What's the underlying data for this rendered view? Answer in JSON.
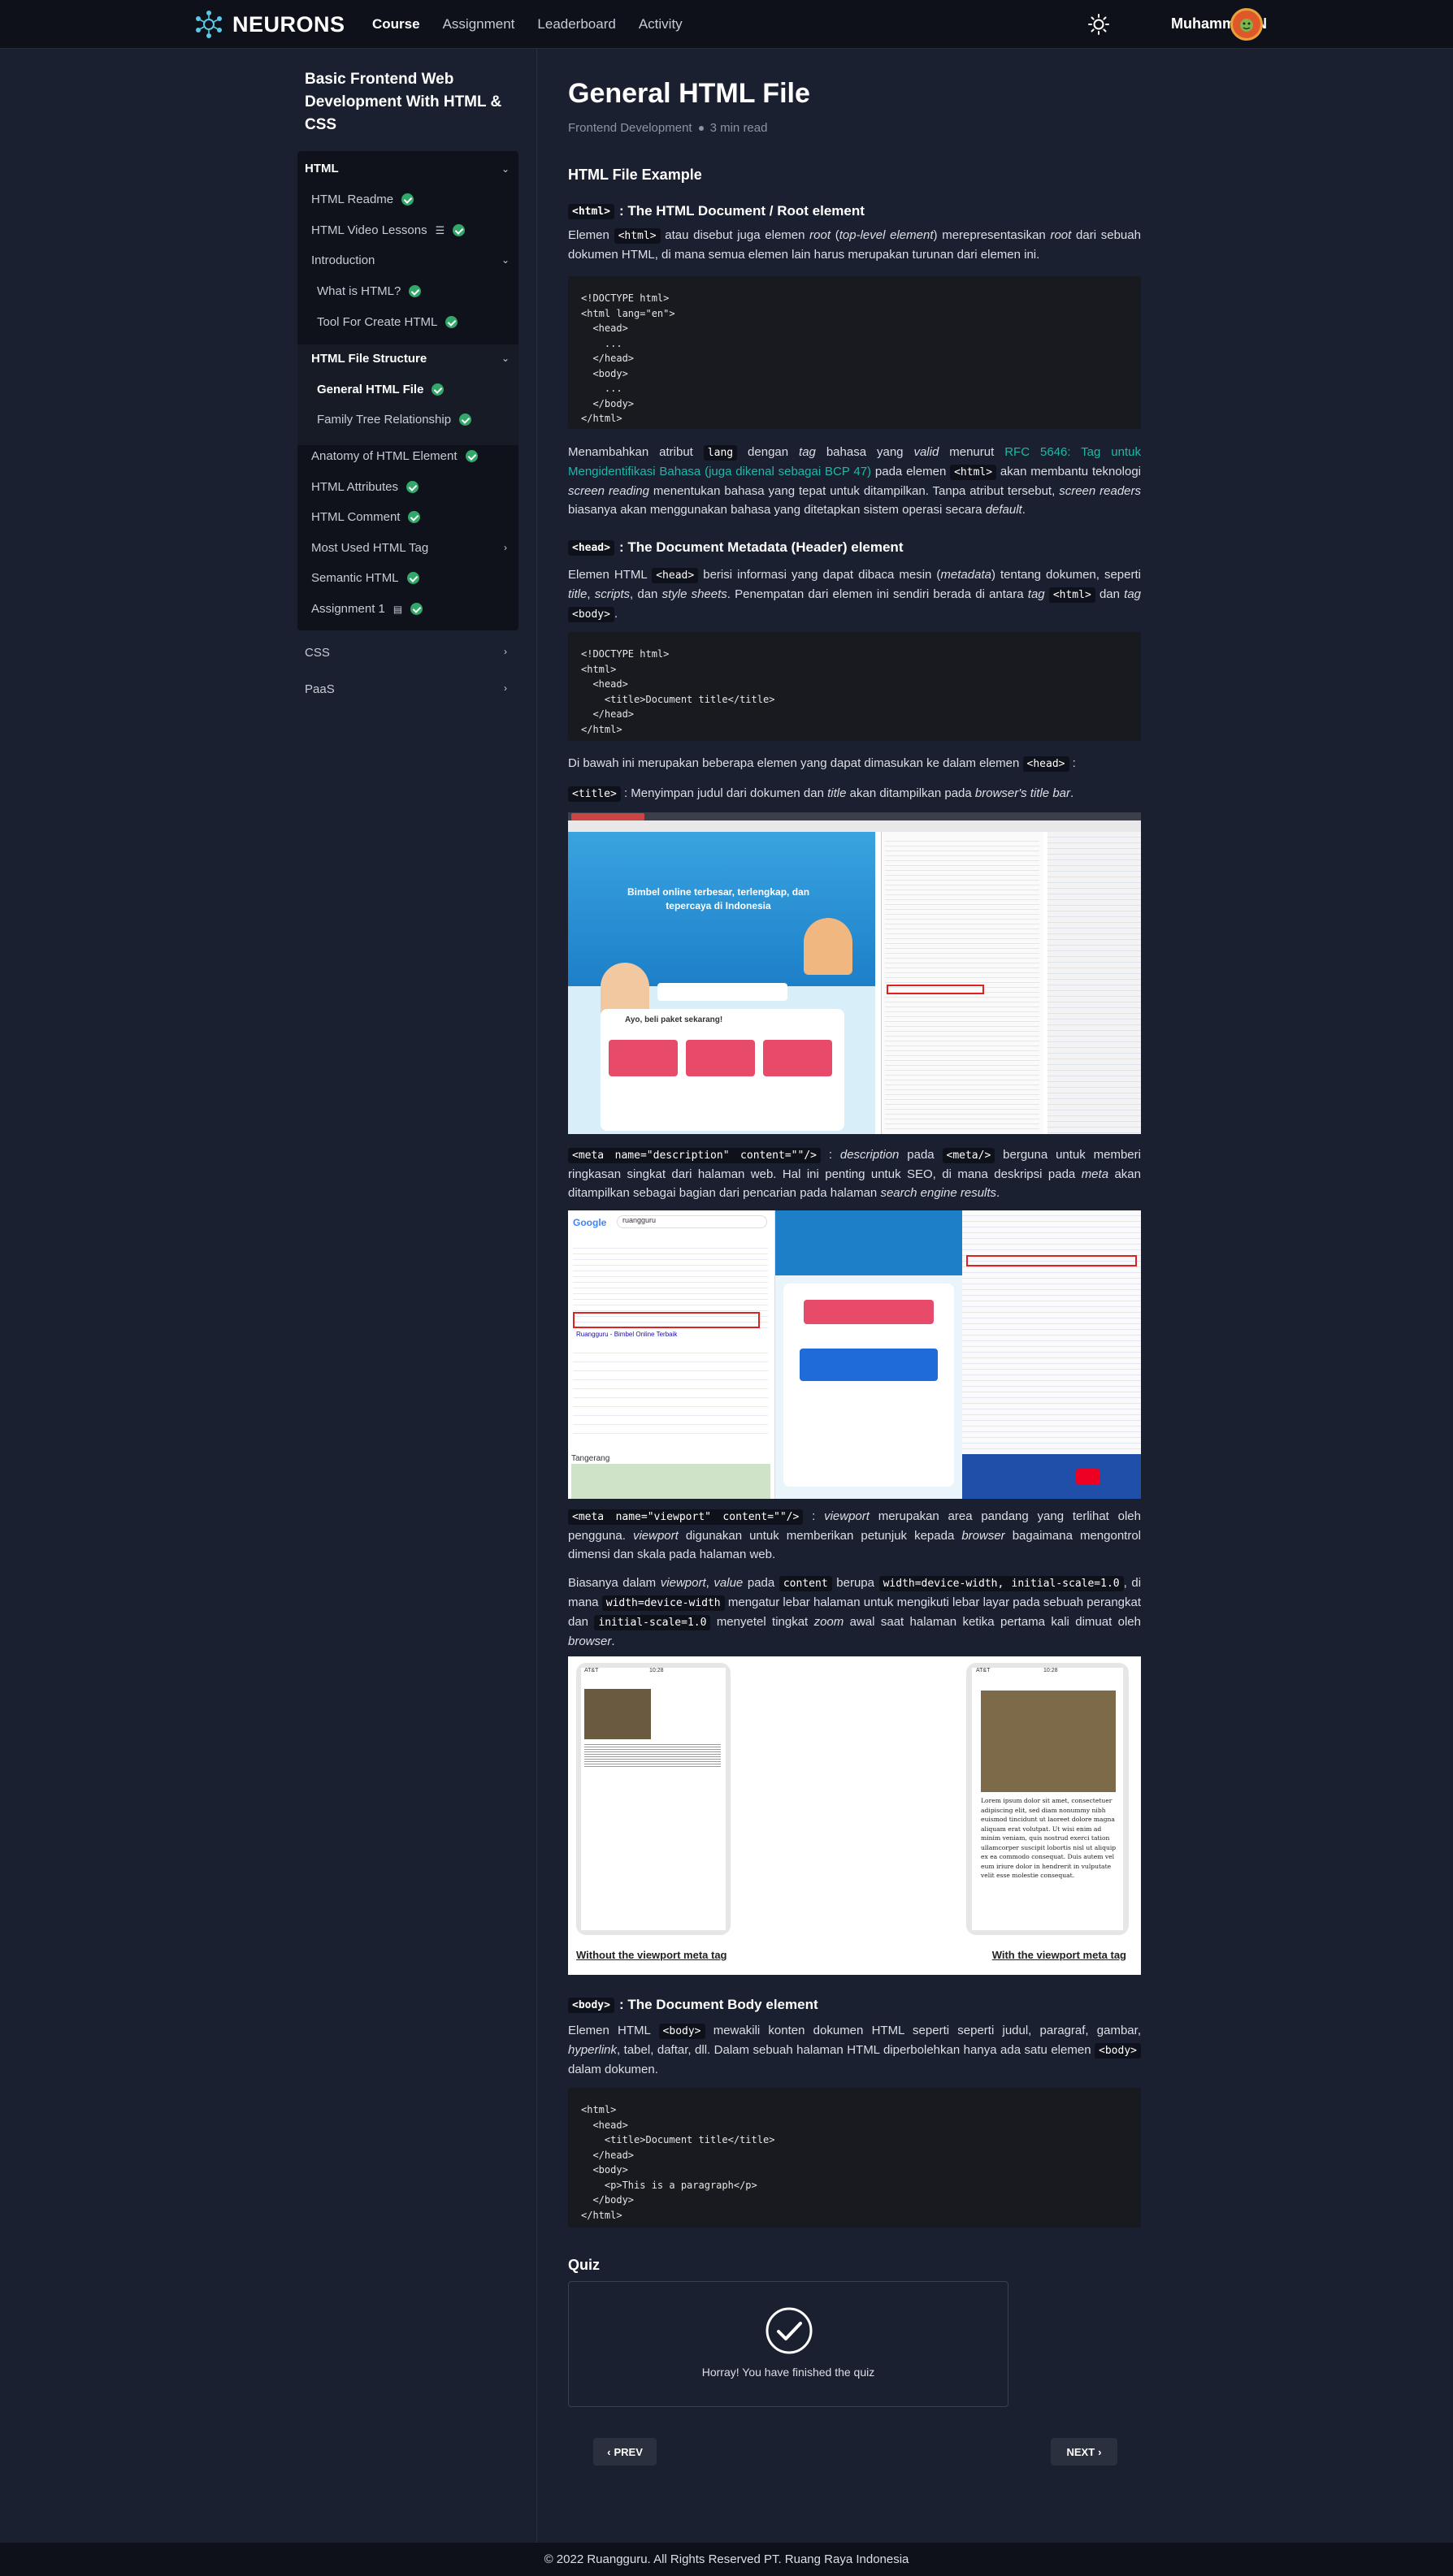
{
  "brand": {
    "name": "NEURONS"
  },
  "nav": {
    "items": [
      "Course",
      "Assignment",
      "Leaderboard",
      "Activity"
    ]
  },
  "user": {
    "name": "Muhammad N"
  },
  "sidebar": {
    "course_title": "Basic Frontend Web Development With HTML & CSS",
    "section_html": "HTML",
    "items": {
      "html_readme": "HTML Readme",
      "html_video": "HTML Video Lessons",
      "introduction": "Introduction",
      "what_is_html": "What is HTML?",
      "tool": "Tool For Create HTML",
      "file_structure": "HTML File Structure",
      "general_html_file": "General HTML File",
      "family_tree": "Family Tree Relationship",
      "anatomy": "Anatomy of HTML Element",
      "attributes": "HTML Attributes",
      "comment": "HTML Comment",
      "most_used": "Most Used HTML Tag",
      "semantic": "Semantic HTML",
      "assignment1": "Assignment 1"
    },
    "section_css": "CSS",
    "section_paas": "PaaS"
  },
  "article": {
    "title": "General HTML File",
    "category": "Frontend Development",
    "read_time": "3 min read",
    "h_example": "HTML File Example",
    "h_html_tag": "<html>",
    "h_html_rest": ": The HTML Document / Root element",
    "p1": {
      "a": "Elemen",
      "code": "<html>",
      "b": "atau disebut juga elemen",
      "em1": "root",
      "c": "(",
      "em2": "top-level element",
      "d": ") merepresentasikan",
      "em3": "root",
      "e": "dari sebuah dokumen HTML, di mana semua elemen lain harus merupakan turunan dari elemen ini."
    },
    "code1": "<!DOCTYPE html>\n<html lang=\"en\">\n  <head>\n    ...\n  </head>\n  <body>\n    ...\n  </body>\n</html>",
    "p2": {
      "a": "Menambahkan atribut",
      "code1": "lang",
      "b": "dengan",
      "em1": "tag",
      "c": "bahasa yang",
      "em2": "valid",
      "d": "menurut",
      "link": "RFC 5646: Tag untuk Mengidentifikasi Bahasa (juga dikenal sebagai BCP 47)",
      "e": "pada elemen",
      "code2": "<html>",
      "f": "akan membantu teknologi",
      "em3": "screen reading",
      "g": "menentukan bahasa yang tepat untuk ditampilkan. Tanpa atribut tersebut,",
      "em4": "screen readers",
      "h": "biasanya akan menggunakan bahasa yang ditetapkan sistem operasi secara",
      "em5": "default",
      "i": "."
    },
    "h_head_tag": "<head>",
    "h_head_rest": ": The Document Metadata (Header) element",
    "p3": {
      "a": "Elemen HTML",
      "code1": "<head>",
      "b": "berisi informasi yang dapat dibaca mesin (",
      "em1": "metadata",
      "c": ") tentang dokumen, seperti",
      "em2": "title",
      "d": ",",
      "em3": "scripts",
      "e": ", dan",
      "em4": "style sheets",
      "f": ". Penempatan dari elemen ini sendiri berada di antara",
      "em5": "tag",
      "code2": "<html>",
      "g": "dan",
      "em6": "tag",
      "code3": "<body>",
      "h": "."
    },
    "code2": "<!DOCTYPE html>\n<html>\n  <head>\n    <title>Document title</title>\n  </head>\n</html>",
    "p4": {
      "a": "Di bawah ini merupakan beberapa elemen yang dapat dimasukan ke dalam elemen",
      "code": "<head>",
      "b": ":"
    },
    "p5": {
      "code": "<title>",
      "a": ": Menyimpan judul dari dokumen dan",
      "em1": "title",
      "b": "akan ditampilkan pada",
      "em2": "browser's title bar",
      "c": "."
    },
    "screenshot1": {
      "headline": "Bimbel online terbesar, terlengkap, dan tepercaya di Indonesia",
      "cta": "Ayo, beli paket sekarang!"
    },
    "p6": {
      "code1": "<meta name=\"description\" content=\"\"/>",
      "a": ":",
      "em1": "description",
      "b": "pada",
      "code2": "<meta/>",
      "c": "berguna untuk memberi ringkasan singkat dari halaman web. Hal ini penting untuk SEO, di mana deskripsi pada",
      "em2": "meta",
      "d": "akan ditampilkan sebagai bagian dari pencarian pada halaman",
      "em3": "search engine results",
      "e": "."
    },
    "screenshot2": {
      "google": "Google",
      "query": "ruangguru",
      "result_title": "Ruangguru - Bimbel Online Terbaik",
      "map_label": "Tangerang"
    },
    "p7": {
      "code": "<meta name=\"viewport\" content=\"\"/>",
      "a": ":",
      "em1": "viewport",
      "b": "merupakan area pandang yang terlihat oleh pengguna.",
      "em2": "viewport",
      "c": "digunakan untuk memberikan petunjuk kepada",
      "em3": "browser",
      "d": "bagaimana mengontrol dimensi dan skala pada halaman web."
    },
    "p8": {
      "a": "Biasanya dalam",
      "em1": "viewport",
      "b": ",",
      "em2": "value",
      "c": "pada",
      "code1": "content",
      "d": "berupa",
      "code2": "width=device-width, initial-scale=1.0",
      "e": ", di mana",
      "code3": "width=device-width",
      "f": "mengatur lebar halaman untuk mengikuti lebar layar pada sebuah perangkat dan",
      "code4": "initial-scale=1.0",
      "g": "menyetel tingkat",
      "em3": "zoom",
      "h": "awal saat halaman ketika pertama kali dimuat oleh",
      "em4": "browser",
      "i": "."
    },
    "viewport_img": {
      "left_caption": "Without the viewport meta tag",
      "right_caption": "With the viewport meta tag",
      "carrier": "AT&T",
      "time": "10:28",
      "lorem": "Lorem ipsum dolor sit amet, consectetuer adipiscing elit, sed diam nonummy nibh euismod tincidunt ut laoreet dolore magna aliquam erat volutpat. Ut wisi enim ad minim veniam, quis nostrud exerci tation ullamcorper suscipit lobortis nisl ut aliquip ex ea commodo consequat. Duis autem vel eum iriure dolor in hendrerit in vulputate velit esse molestie consequat."
    },
    "h_body_tag": "<body>",
    "h_body_rest": ": The Document Body element",
    "p9": {
      "a": "Elemen HTML",
      "code1": "<body>",
      "b": "mewakili konten dokumen HTML seperti seperti judul, paragraf, gambar,",
      "em1": "hyperlink",
      "c": ", tabel, daftar, dll. Dalam sebuah halaman HTML diperbolehkan hanya ada satu elemen",
      "code2": "<body>",
      "d": "dalam dokumen."
    },
    "code3": "<html>\n  <head>\n    <title>Document title</title>\n  </head>\n  <body>\n    <p>This is a paragraph</p>\n  </body>\n</html>"
  },
  "quiz": {
    "title": "Quiz",
    "message": "Horray! You have finished the quiz"
  },
  "pager": {
    "prev": "PREV",
    "next": "NEXT"
  },
  "footer": {
    "text": "© 2022 Ruangguru. All Rights Reserved PT. Ruang Raya Indonesia"
  }
}
